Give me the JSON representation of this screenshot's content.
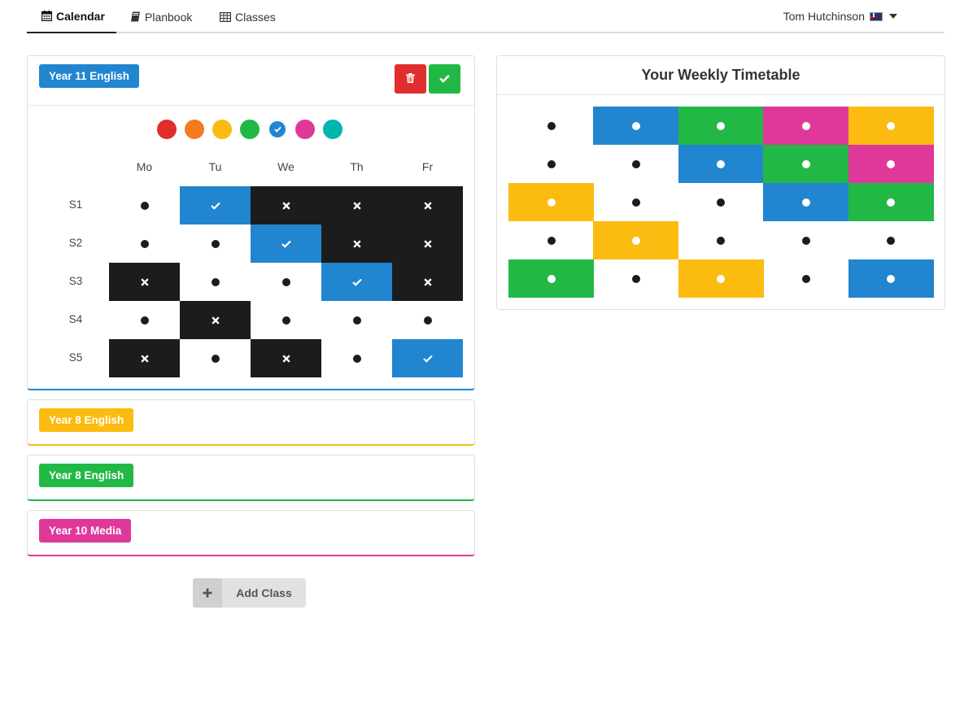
{
  "nav": {
    "tabs": [
      {
        "label": "Calendar",
        "icon": "calendar-icon"
      },
      {
        "label": "Planbook",
        "icon": "book-icon"
      },
      {
        "label": "Classes",
        "icon": "table-icon"
      }
    ],
    "user": "Tom Hutchinson"
  },
  "colors": {
    "red": "#e02d2d",
    "orange": "#f47a20",
    "yellow": "#fbbb10",
    "green": "#22b845",
    "blue": "#2185d0",
    "pink": "#e0389a",
    "teal": "#00b5ad",
    "black": "#1b1c1d"
  },
  "active_class": {
    "name": "Year 11 English",
    "color": "blue",
    "swatches": [
      "red",
      "orange",
      "yellow",
      "green",
      "blue",
      "pink",
      "teal"
    ],
    "selected_swatch": "blue",
    "days": [
      "Mo",
      "Tu",
      "We",
      "Th",
      "Fr"
    ],
    "sessions": [
      "S1",
      "S2",
      "S3",
      "S4",
      "S5"
    ],
    "grid": [
      [
        "free",
        "selected",
        "taken",
        "taken",
        "taken"
      ],
      [
        "free",
        "free",
        "selected",
        "taken",
        "taken"
      ],
      [
        "taken",
        "free",
        "free",
        "selected",
        "taken"
      ],
      [
        "free",
        "taken",
        "free",
        "free",
        "free"
      ],
      [
        "taken",
        "free",
        "taken",
        "free",
        "selected"
      ]
    ]
  },
  "classes": [
    {
      "name": "Year 8 English",
      "color": "yellow"
    },
    {
      "name": "Year 8 English",
      "color": "green"
    },
    {
      "name": "Year 10 Media",
      "color": "pink"
    }
  ],
  "timetable": {
    "title": "Your Weekly Timetable",
    "grid": [
      [
        "",
        "blue",
        "green",
        "pink",
        "yellow"
      ],
      [
        "",
        "",
        "blue",
        "green",
        "pink"
      ],
      [
        "yellow",
        "",
        "",
        "blue",
        "green"
      ],
      [
        "",
        "yellow",
        "",
        "",
        ""
      ],
      [
        "green",
        "",
        "yellow",
        "",
        "blue"
      ]
    ]
  },
  "add_class_label": "Add Class"
}
